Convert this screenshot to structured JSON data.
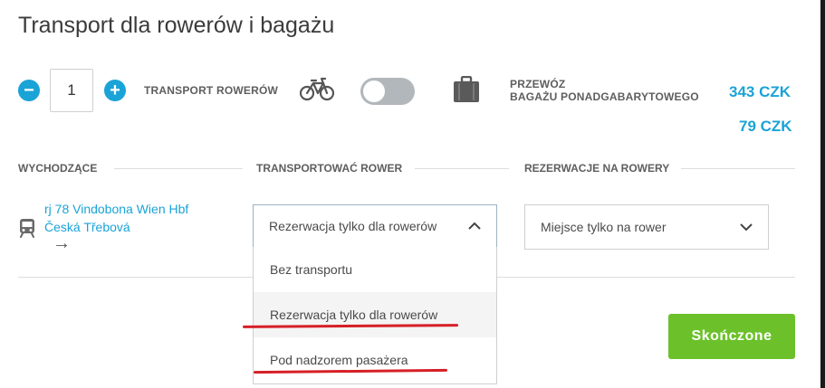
{
  "dialog": {
    "title": "Transport dla rowerów i bagażu"
  },
  "bike_transport": {
    "minus_label": "−",
    "plus_label": "+",
    "quantity": "1",
    "label": "TRANSPORT ROWERÓW",
    "icon": "bicycle-icon",
    "toggle_on": false
  },
  "luggage": {
    "icon": "suitcase-icon",
    "label_line1": "PRZEWÓZ",
    "label_line2": "BAGAŻU PONADGABARYTOWEGO"
  },
  "prices": {
    "first": "343 CZK",
    "second": "79 CZK"
  },
  "table": {
    "headers": {
      "outbound": "WYCHODZĄCE",
      "transport": "TRANSPORTOWAĆ ROWER",
      "reservation": "REZERWACJE NA ROWERY"
    },
    "row": {
      "train_icon": "train-icon",
      "train_name": "rj 78 Vindobona Wien Hbf",
      "station": "Česká Třebová",
      "arrow": "→",
      "transport_select": "Rezerwacja tylko dla rowerów",
      "reservation_select": "Miejsce tylko na rower"
    }
  },
  "dropdown": {
    "options": [
      "Bez transportu",
      "Rezerwacja tylko dla rowerów",
      "Pod nadzorem pasażera"
    ],
    "highlighted_index": 1
  },
  "actions": {
    "done_label": "Skończone"
  },
  "colors": {
    "accent": "#1aa3d6",
    "done": "#6cc12b",
    "annotation": "#d61f26"
  }
}
